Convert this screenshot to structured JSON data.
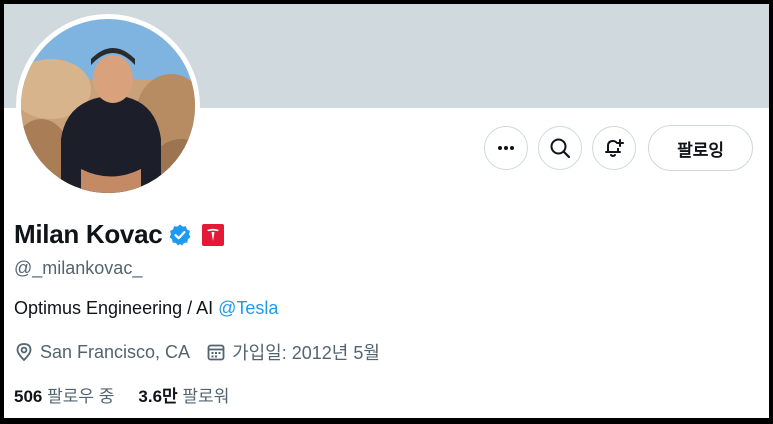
{
  "profile": {
    "name": "Milan Kovac",
    "handle": "@_milankovac_",
    "bio_text": "Optimus Engineering / AI ",
    "bio_mention": "@Tesla",
    "location": "San Francisco, CA",
    "joined": "가입일: 2012년 5월",
    "following_count": "506",
    "following_label": "팔로우 중",
    "followers_count": "3.6만",
    "followers_label": "팔로워"
  },
  "actions": {
    "follow_label": "팔로잉",
    "icons": [
      "more-icon",
      "search-icon",
      "notification-add-icon"
    ]
  },
  "colors": {
    "banner": "#cfd9de",
    "accent": "#1d9bf0",
    "verified": "#1d9bf0",
    "affiliate_badge": "#e31937"
  }
}
